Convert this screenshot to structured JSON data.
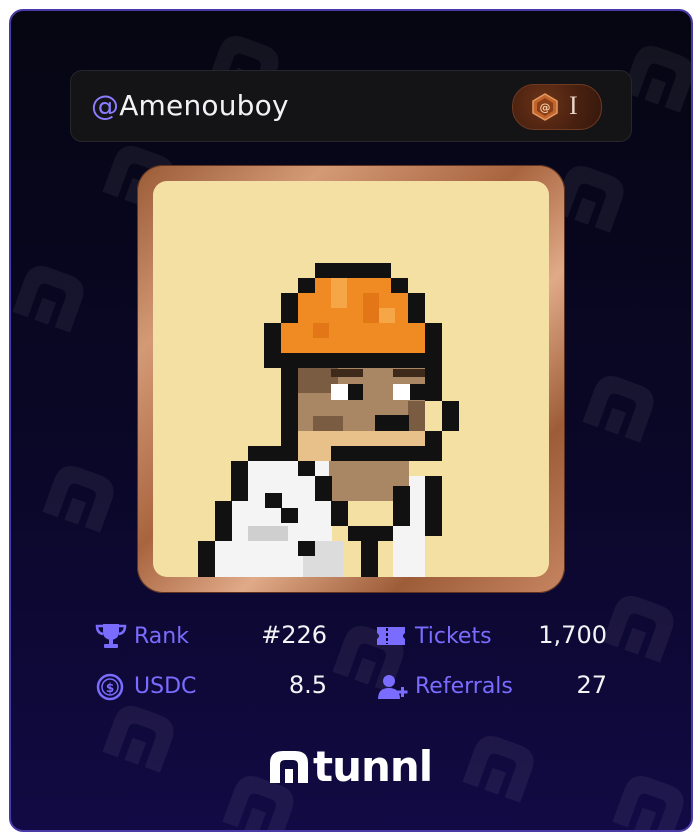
{
  "profile": {
    "handle_at": "@",
    "handle_name": "Amenouboy",
    "badge_caret": "I"
  },
  "avatar": {
    "description_icon": "pixel-character-hardhat"
  },
  "stats": {
    "rank": {
      "label": "Rank",
      "value": "#226",
      "icon": "trophy-icon"
    },
    "tickets": {
      "label": "Tickets",
      "value": "1,700",
      "icon": "ticket-icon"
    },
    "usdc": {
      "label": "USDC",
      "value": "8.5",
      "icon": "dollar-coin-icon"
    },
    "referrals": {
      "label": "Referrals",
      "value": "27",
      "icon": "add-user-icon"
    }
  },
  "brand": {
    "logo_text": "tunnl"
  },
  "colors": {
    "accent": "#7a6cff",
    "frame": "#b87550",
    "avatar_bg": "#f5e0a4",
    "helmet": "#f08a22"
  }
}
